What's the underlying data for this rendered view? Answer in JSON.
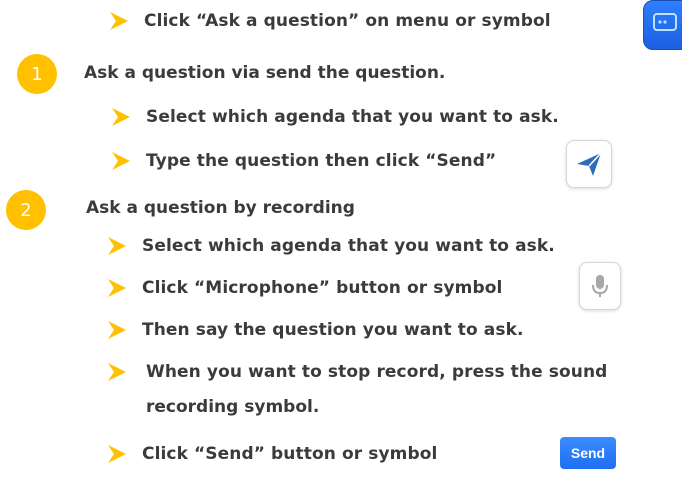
{
  "colors": {
    "badge": "#ffc000",
    "arrow": "#ffc000",
    "accent_blue": "#1e6ff2",
    "text": "#3b3b3b"
  },
  "intro": {
    "step_text": "Click “Ask a question” on menu or symbol",
    "icon": "chat-bubble-icon"
  },
  "section1": {
    "number": "1",
    "heading": "Ask a question via send the question.",
    "steps": [
      "Select which agenda that you want to ask.",
      "Type the question then click “Send”"
    ],
    "icon": "paper-plane-icon"
  },
  "section2": {
    "number": "2",
    "heading": "Ask a question by recording",
    "steps": [
      "Select which agenda that you want to ask.",
      "Click “Microphone” button or symbol",
      "Then say the question you want to ask.",
      "When you want to stop record, press the sound",
      "recording symbol.",
      "Click “Send” button or symbol"
    ],
    "mic_icon": "microphone-icon",
    "send_label": "Send"
  }
}
